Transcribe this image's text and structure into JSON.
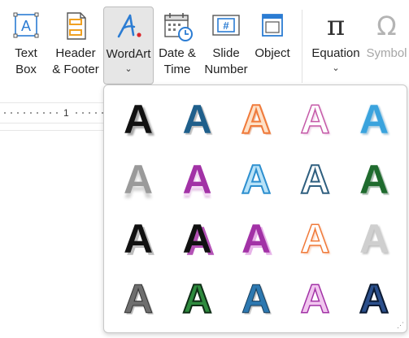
{
  "ribbon": {
    "buttons": [
      {
        "name": "text-box-button",
        "label1": "Text",
        "label2": "Box",
        "icon": "text-box-icon"
      },
      {
        "name": "header-footer-button",
        "label1": "Header",
        "label2": "& Footer",
        "icon": "header-footer-icon"
      },
      {
        "name": "wordart-button",
        "label1": "WordArt",
        "label2": "",
        "icon": "wordart-icon",
        "chevron": "⌄"
      },
      {
        "name": "date-time-button",
        "label1": "Date &",
        "label2": "Time",
        "icon": "calendar-clock-icon"
      },
      {
        "name": "slide-number-button",
        "label1": "Slide",
        "label2": "Number",
        "icon": "slide-number-icon"
      },
      {
        "name": "object-button",
        "label1": "Object",
        "label2": "",
        "icon": "object-icon"
      },
      {
        "name": "equation-button",
        "label1": "Equation",
        "label2": "",
        "icon": "pi-icon",
        "chevron": "⌄"
      },
      {
        "name": "symbol-button",
        "label1": "Symbol",
        "label2": "",
        "icon": "omega-icon"
      }
    ],
    "equation_glyph": "π",
    "symbol_glyph": "Ω",
    "text_box_glyph": "A",
    "slide_number_glyph": "#"
  },
  "ruler": {
    "number": "1"
  },
  "gallery": {
    "glyph": "A",
    "styles": [
      "s1",
      "s2",
      "s3",
      "s4",
      "s5",
      "s6",
      "s7",
      "s8",
      "s9",
      "s10",
      "s11",
      "s12",
      "s13",
      "s14",
      "s15",
      "s16",
      "s17",
      "s18",
      "s19",
      "s20"
    ],
    "resize_grip": "⋰"
  },
  "colors": {
    "accent_blue": "#2b7cd3",
    "active_bg": "#e6e6e6",
    "disabled_text": "#a6a6a6"
  }
}
